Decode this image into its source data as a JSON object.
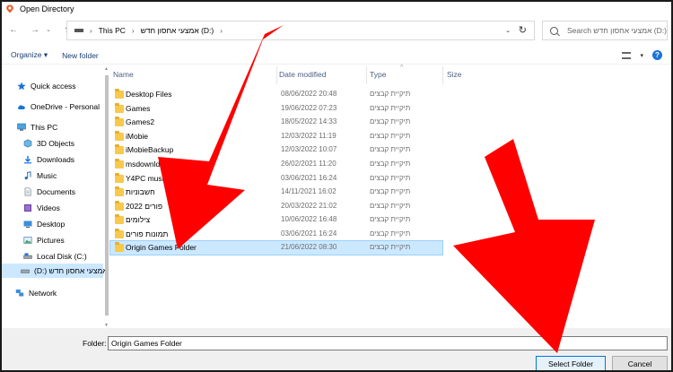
{
  "window": {
    "title": "Open Directory"
  },
  "navigation": {
    "back_icon": "arrow-left-icon",
    "forward_icon": "arrow-right-icon",
    "recent_icon": "chevron-down-icon",
    "up_icon": "arrow-up-icon",
    "address_segments": [
      "This PC",
      "אמצעי אחסון חדש (D:)"
    ],
    "address_sep": "›",
    "search_placeholder": "Search אמצעי אחסון חדש (D:)"
  },
  "toolbar": {
    "organize_label": "Organize ▾",
    "new_folder_label": "New folder",
    "help_label": "?"
  },
  "sidebar": {
    "items": [
      {
        "label": "Quick access",
        "icon": "star-icon"
      },
      {
        "label": "OneDrive - Personal",
        "icon": "cloud-icon"
      },
      {
        "label": "This PC",
        "icon": "computer-icon"
      },
      {
        "label": "3D Objects",
        "icon": "cube-icon"
      },
      {
        "label": "Downloads",
        "icon": "download-icon"
      },
      {
        "label": "Music",
        "icon": "music-icon"
      },
      {
        "label": "Documents",
        "icon": "document-icon"
      },
      {
        "label": "Videos",
        "icon": "video-icon"
      },
      {
        "label": "Desktop",
        "icon": "desktop-icon"
      },
      {
        "label": "Pictures",
        "icon": "picture-icon"
      },
      {
        "label": "Local Disk (C:)",
        "icon": "drive-icon"
      },
      {
        "label": "(D:) אמצעי אחסון חדש",
        "icon": "drive-icon",
        "selected": true
      },
      {
        "label": "Network",
        "icon": "network-icon"
      }
    ]
  },
  "columns": {
    "name": "Name",
    "date_modified": "Date modified",
    "type": "Type",
    "size": "Size"
  },
  "files": [
    {
      "name": "Desktop Files",
      "date": "08/06/2022 20:48",
      "type": "תיקיית קבצים"
    },
    {
      "name": "Games",
      "date": "19/06/2022 07:23",
      "type": "תיקיית קבצים"
    },
    {
      "name": "Games2",
      "date": "18/05/2022 14:33",
      "type": "תיקיית קבצים"
    },
    {
      "name": "iMobie",
      "date": "12/03/2022 11:19",
      "type": "תיקיית קבצים"
    },
    {
      "name": "iMobieBackup",
      "date": "12/03/2022 10:07",
      "type": "תיקיית קבצים"
    },
    {
      "name": "msdownld.tmp",
      "date": "26/02/2021 11:20",
      "type": "תיקיית קבצים"
    },
    {
      "name": "Y4PC music",
      "date": "03/06/2021 16:24",
      "type": "תיקיית קבצים"
    },
    {
      "name": "חשבוניות",
      "date": "14/11/2021 16:02",
      "type": "תיקיית קבצים"
    },
    {
      "name": "פורים 2022",
      "date": "20/03/2022 21:02",
      "type": "תיקיית קבצים"
    },
    {
      "name": "צילומים",
      "date": "10/06/2022 16:48",
      "type": "תיקיית קבצים"
    },
    {
      "name": "תמונות פורים",
      "date": "03/06/2021 16:24",
      "type": "תיקיית קבצים"
    },
    {
      "name": "Origin Games Folder",
      "date": "21/06/2022 08:30",
      "type": "תיקיית קבצים",
      "selected": true
    }
  ],
  "footer": {
    "folder_label": "Folder:",
    "folder_value": "Origin Games Folder",
    "select_button": "Select Folder",
    "cancel_button": "Cancel"
  },
  "colors": {
    "selection": "#cce8ff",
    "folder": "#f7c94d",
    "annotation_arrow": "#ff0000",
    "accent": "#0078d7"
  }
}
